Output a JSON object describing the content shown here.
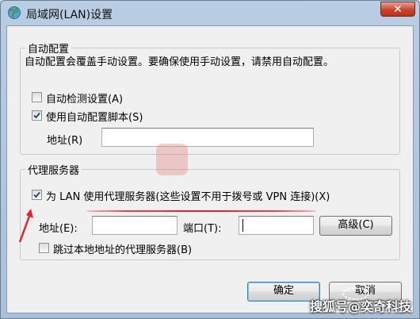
{
  "window": {
    "title": "局域网(LAN)设置",
    "close_label": "✕"
  },
  "auto_config": {
    "legend": "自动配置",
    "description": "自动配置会覆盖手动设置。要确保使用手动设置，请禁用自动配置。",
    "auto_detect": {
      "label": "自动检测设置(A)",
      "checked": false
    },
    "use_script": {
      "label": "使用自动配置脚本(S)",
      "checked": true
    },
    "address_label": "地址(R)",
    "address_value": ""
  },
  "proxy": {
    "legend": "代理服务器",
    "use_proxy": {
      "label": "为 LAN 使用代理服务器(这些设置不用于拨号或 VPN 连接)(X)",
      "checked": true
    },
    "address_label": "地址(E):",
    "address_value": "",
    "port_label": "端口(T):",
    "port_value": "",
    "advanced_label": "高级(C)",
    "bypass_local": {
      "label": "跳过本地地址的代理服务器(B)",
      "checked": false
    }
  },
  "footer": {
    "ok_label": "确定",
    "cancel_label": "取消"
  },
  "watermark": {
    "text": "搜狐号@奕奇科技"
  },
  "colors": {
    "annotation_red": "#e0262a",
    "title_gradient": "#b9cde3",
    "client_bg": "#f0f0f0"
  }
}
